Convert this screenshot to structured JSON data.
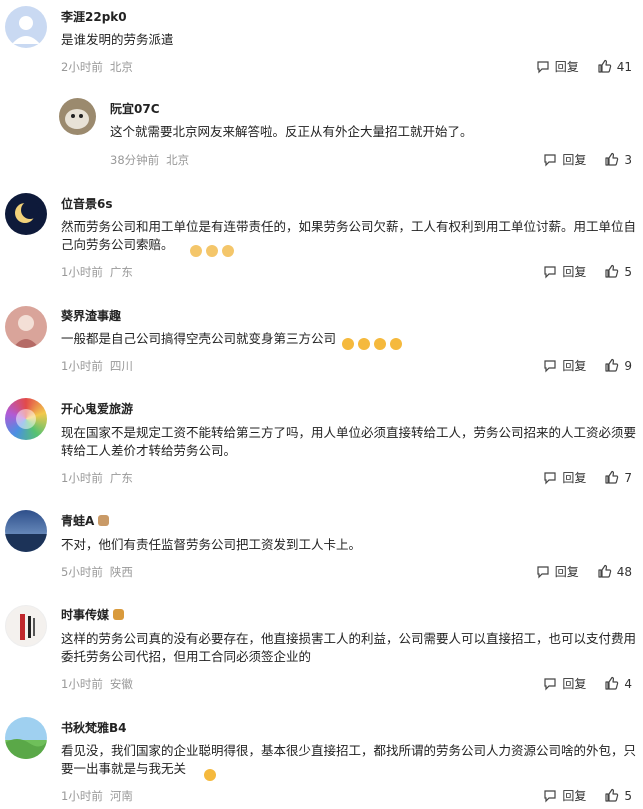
{
  "ui": {
    "reply_label": "回复"
  },
  "comments": [
    {
      "name": "李涯22pk0",
      "text": "是谁发明的劳务派遣",
      "time": "2小时前",
      "location": "北京",
      "likes": "41"
    },
    {
      "name": "阮宜07C",
      "text": "这个就需要北京网友来解答啦。反正从有外企大量招工就开始了。",
      "time": "38分钟前",
      "location": "北京",
      "likes": "3"
    },
    {
      "name": "位音景6s",
      "text": "然而劳务公司和用工单位是有连带责任的，如果劳务公司欠薪，工人有权利到用工单位讨薪。用工单位自己向劳务公司索赔。",
      "time": "1小时前",
      "location": "广东",
      "likes": "5"
    },
    {
      "name": "葵界渣事趣",
      "text": "一般都是自己公司搞得空壳公司就变身第三方公司",
      "time": "1小时前",
      "location": "四川",
      "likes": "9"
    },
    {
      "name": "开心鬼爱旅游",
      "text": "现在国家不是规定工资不能转给第三方了吗，用人单位必须直接转给工人，劳务公司招来的人工资必须要转给工人差价才转给劳务公司。",
      "time": "1小时前",
      "location": "广东",
      "likes": "7"
    },
    {
      "name": "青蛙A",
      "text": "不对，他们有责任监督劳务公司把工资发到工人卡上。",
      "time": "5小时前",
      "location": "陕西",
      "likes": "48"
    },
    {
      "name": "时事传媒",
      "text": "这样的劳务公司真的没有必要存在，他直接损害工人的利益，公司需要人可以直接招工，也可以支付费用委托劳务公司代招，但用工合同必须签企业的",
      "time": "1小时前",
      "location": "安徽",
      "likes": "4"
    },
    {
      "name": "书秋梵雅B4",
      "text": "看见没，我们国家的企业聪明得很，基本很少直接招工，都找所谓的劳务公司人力资源公司啥的外包，只要一出事就是与我无关",
      "time": "1小时前",
      "location": "河南",
      "likes": "5"
    }
  ]
}
